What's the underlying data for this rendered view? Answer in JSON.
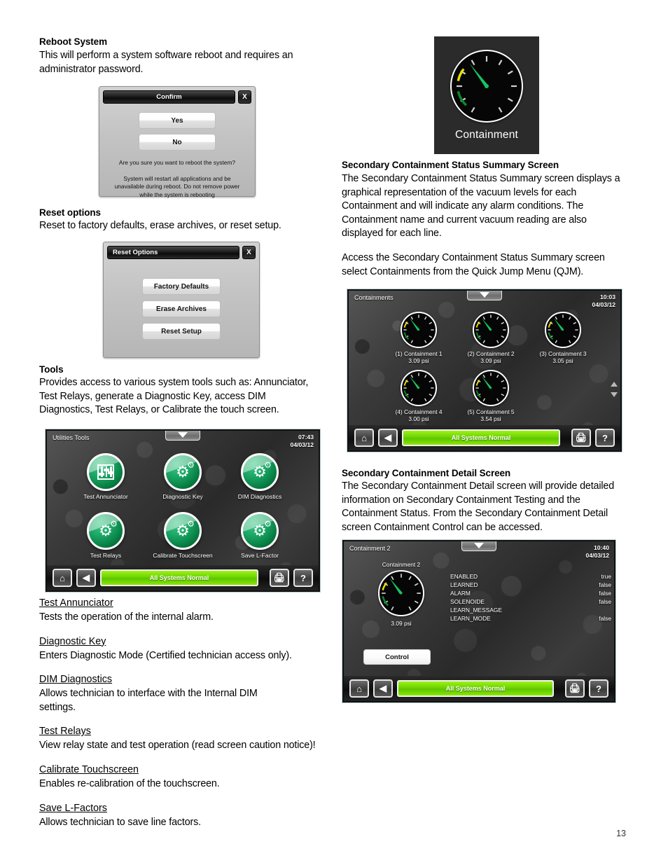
{
  "page": {
    "number": "13"
  },
  "left": {
    "reboot": {
      "heading": "Reboot System",
      "body": "This will perform a system software reboot and requires an administrator password."
    },
    "confirm_dialog": {
      "title": "Confirm",
      "close_label": "X",
      "yes_label": "Yes",
      "no_label": "No",
      "question": "Are you sure you want to reboot the system?",
      "note_line1": "System will restart all applications and be",
      "note_line2": "unavailable during reboot.  Do not remove power",
      "note_line3": "while the system is rebooting"
    },
    "reset": {
      "heading": "Reset options",
      "body": "Reset to factory defaults, erase archives, or reset setup."
    },
    "reset_dialog": {
      "title": "Reset Options",
      "close_label": "X",
      "buttons": [
        "Factory Defaults",
        "Erase Archives",
        "Reset Setup"
      ]
    },
    "tools": {
      "heading": "Tools",
      "body": "Provides access to various system tools such as: Annunciator, Test Relays, generate a Diagnostic Key, access DIM Diagnostics, Test Relays, or Calibrate the touch screen."
    },
    "tools_screen": {
      "title": "Utilities Tools",
      "time": "07:43",
      "date": "04/03/12",
      "status": "All Systems Normal",
      "icons": [
        {
          "label": "Test Annunciator",
          "icon": "sliders-icon"
        },
        {
          "label": "Diagnostic Key",
          "icon": "gears-icon"
        },
        {
          "label": "DIM Diagnostics",
          "icon": "gears-icon"
        },
        {
          "label": "Test Relays",
          "icon": "gears-icon"
        },
        {
          "label": "Calibrate Touchscreen",
          "icon": "gears-icon"
        },
        {
          "label": "Save L-Factor",
          "icon": "gears-icon"
        }
      ],
      "nav": {
        "home": "home-icon",
        "back": "back-arrow-icon",
        "print": "printer-icon",
        "help": "?"
      }
    },
    "tool_defs": [
      {
        "term": "Test Annunciator",
        "desc": "Tests the operation of the internal alarm."
      },
      {
        "term": "Diagnostic Key",
        "desc": "Enters Diagnostic Mode (Certified technician access only)."
      },
      {
        "term": "DIM Diagnostics",
        "desc": "Allows technician to interface with the Internal DIM settings."
      },
      {
        "term": "Test Relays",
        "desc": "View relay state and test operation (read screen caution notice)!"
      },
      {
        "term": "Calibrate Touchscreen",
        "desc": "Enables re-calibration of the touchscreen."
      },
      {
        "term": "Save L-Factors",
        "desc": "Allows technician to save line factors."
      }
    ]
  },
  "right": {
    "containment_tile": {
      "label": "Containment",
      "icon": "gauge-icon"
    },
    "summary": {
      "heading": "Secondary Containment Status Summary Screen",
      "body1": "The Secondary Containment Status Summary screen displays a graphical representation of the vacuum levels for each Containment and will indicate any alarm conditions. The Containment name and current vacuum reading are also displayed for each line.",
      "body2": "Access the Secondary Containment Status Summary screen select Containments from the Quick Jump Menu (QJM)."
    },
    "summary_screen": {
      "title": "Containments",
      "time": "10:03",
      "date": "04/03/12",
      "status": "All Systems Normal",
      "gauges": [
        {
          "name": "(1) Containment 1",
          "value": "3.09 psi"
        },
        {
          "name": "(2) Containment 2",
          "value": "3.09 psi"
        },
        {
          "name": "(3) Containment 3",
          "value": "3.05 psi"
        },
        {
          "name": "(4) Containment 4",
          "value": "3.00 psi"
        },
        {
          "name": "(5) Containment 5",
          "value": "3.54 psi"
        }
      ],
      "nav": {
        "home": "home-icon",
        "back": "back-arrow-icon",
        "print": "printer-icon",
        "help": "?"
      }
    },
    "detail": {
      "heading": "Secondary Containment Detail Screen",
      "body": "The Secondary Containment Detail screen will provide detailed information on Secondary Containment Testing and the Containment Status. From the Secondary Containment Detail screen Containment Control can be accessed."
    },
    "detail_screen": {
      "title": "Containment 2",
      "time": "10:40",
      "date": "04/03/12",
      "gauge_name": "Containment 2",
      "gauge_value": "3.09 psi",
      "control_label": "Control",
      "status": "All Systems Normal",
      "rows": [
        {
          "key": "ENABLED",
          "value": "true"
        },
        {
          "key": "LEARNED",
          "value": "false"
        },
        {
          "key": "ALARM",
          "value": "false"
        },
        {
          "key": "SOLENOIDE",
          "value": "false"
        },
        {
          "key": "LEARN_MESSAGE",
          "value": ""
        },
        {
          "key": "LEARN_MODE",
          "value": "false"
        }
      ],
      "nav": {
        "home": "home-icon",
        "back": "back-arrow-icon",
        "print": "printer-icon",
        "help": "?"
      }
    }
  },
  "colors": {
    "accent_green": "#6ed400",
    "gauge_needle": "#16c463",
    "warn_yellow": "#e8e000"
  }
}
